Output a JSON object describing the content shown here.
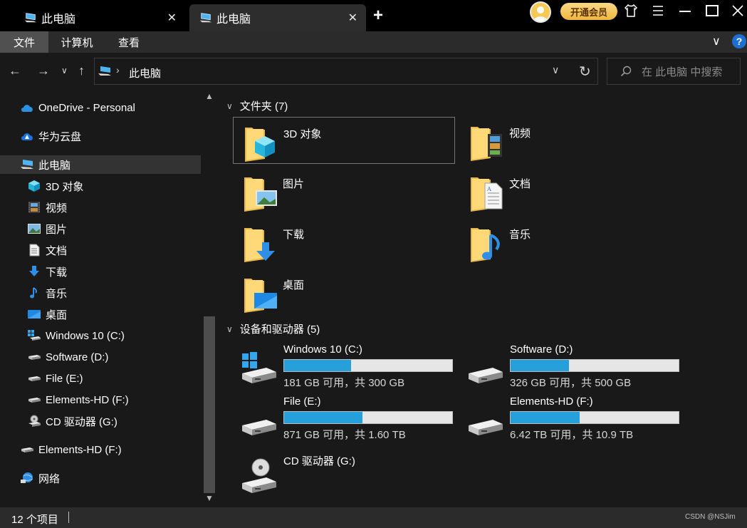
{
  "tabs": [
    {
      "label": "此电脑",
      "close": "✕"
    },
    {
      "label": "此电脑",
      "close": "✕"
    }
  ],
  "tab_add": "+",
  "vip_button": "开通会员",
  "ribbon": {
    "file": "文件",
    "computer": "计算机",
    "view": "查看",
    "chevron": "∨",
    "help": "?"
  },
  "nav": {
    "back": "←",
    "forward": "→",
    "recent": "∨",
    "up": "↑"
  },
  "address": {
    "separator": "›",
    "crumb": "此电脑",
    "dropdown": "∨",
    "refresh": "↻"
  },
  "search": {
    "placeholder": "在 此电脑 中搜索"
  },
  "sidebar": {
    "items": [
      {
        "label": "OneDrive - Personal",
        "icon": "onedrive-icon"
      },
      {
        "label": "华为云盘",
        "icon": "huawei-cloud-icon"
      },
      {
        "label": "此电脑",
        "icon": "this-pc-icon"
      },
      {
        "label": "3D 对象",
        "icon": "3d-objects-icon"
      },
      {
        "label": "视频",
        "icon": "videos-icon"
      },
      {
        "label": "图片",
        "icon": "pictures-icon"
      },
      {
        "label": "文档",
        "icon": "documents-icon"
      },
      {
        "label": "下载",
        "icon": "downloads-icon"
      },
      {
        "label": "音乐",
        "icon": "music-icon"
      },
      {
        "label": "桌面",
        "icon": "desktop-icon"
      },
      {
        "label": "Windows 10 (C:)",
        "icon": "windows-drive-icon"
      },
      {
        "label": "Software (D:)",
        "icon": "drive-icon"
      },
      {
        "label": "File (E:)",
        "icon": "drive-icon"
      },
      {
        "label": "Elements-HD (F:)",
        "icon": "drive-icon"
      },
      {
        "label": "CD 驱动器 (G:)",
        "icon": "cd-drive-icon"
      },
      {
        "label": "Elements-HD (F:)",
        "icon": "drive-icon"
      },
      {
        "label": "网络",
        "icon": "network-icon"
      }
    ],
    "scroll_up": "▲",
    "scroll_down": "▼"
  },
  "main": {
    "folders_header": "文件夹 (7)",
    "folders": [
      {
        "label": "3D 对象",
        "icon": "3d-objects-icon"
      },
      {
        "label": "视频",
        "icon": "videos-icon"
      },
      {
        "label": "图片",
        "icon": "pictures-icon"
      },
      {
        "label": "文档",
        "icon": "documents-icon"
      },
      {
        "label": "下载",
        "icon": "downloads-icon"
      },
      {
        "label": "音乐",
        "icon": "music-icon"
      },
      {
        "label": "桌面",
        "icon": "desktop-icon"
      }
    ],
    "drives_header": "设备和驱动器 (5)",
    "drives": [
      {
        "name": "Windows 10 (C:)",
        "info": "181 GB 可用，共 300 GB",
        "used_fraction": 0.397
      },
      {
        "name": "Software (D:)",
        "info": "326 GB 可用，共 500 GB",
        "used_fraction": 0.348
      },
      {
        "name": "File (E:)",
        "info": "871 GB 可用，共 1.60 TB",
        "used_fraction": 0.468
      },
      {
        "name": "Elements-HD (F:)",
        "info": "6.42 TB 可用，共 10.9 TB",
        "used_fraction": 0.411
      },
      {
        "name": "CD 驱动器 (G:)"
      }
    ]
  },
  "status": {
    "count": "12 个项目",
    "watermark": "CSDN @NSJim"
  },
  "colors": {
    "accent": "#26a0da",
    "background": "#191919",
    "selected": "#333333",
    "vip": "#f0b63d"
  }
}
